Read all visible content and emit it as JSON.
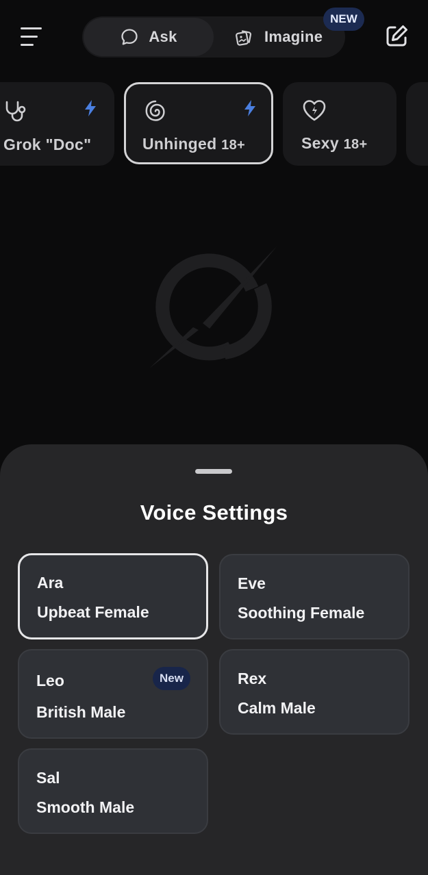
{
  "header": {
    "menu_icon": "hamburger-menu-icon",
    "modes": [
      {
        "label": "Ask",
        "icon": "chat-bubble-icon",
        "active": true
      },
      {
        "label": "Imagine",
        "icon": "image-stack-icon",
        "active": false
      }
    ],
    "imagine_badge": "NEW",
    "compose_icon": "new-chat-edit-icon"
  },
  "personas": [
    {
      "label": "Grok \"Doc\"",
      "age": "",
      "icon": "stethoscope-icon",
      "bolt": true
    },
    {
      "label": "Unhinged",
      "age": "18+",
      "icon": "spiral-icon",
      "bolt": true,
      "selected": true
    },
    {
      "label": "Sexy",
      "age": "18+",
      "icon": "heart-bolt-icon",
      "bolt": false
    }
  ],
  "sheet": {
    "title": "Voice Settings",
    "voices": [
      {
        "name": "Ara",
        "description": "Upbeat Female",
        "selected": true,
        "badge": ""
      },
      {
        "name": "Eve",
        "description": "Soothing Female",
        "selected": false,
        "badge": ""
      },
      {
        "name": "Leo",
        "description": "British Male",
        "selected": false,
        "badge": "New"
      },
      {
        "name": "Rex",
        "description": "Calm Male",
        "selected": false,
        "badge": ""
      },
      {
        "name": "Sal",
        "description": "Smooth Male",
        "selected": false,
        "badge": ""
      }
    ]
  },
  "colors": {
    "background": "#0b0b0c",
    "sheet": "#262628",
    "card": "#2f3136",
    "accent_blue": "#4a7fe0",
    "badge_bg": "#1c2b52"
  }
}
